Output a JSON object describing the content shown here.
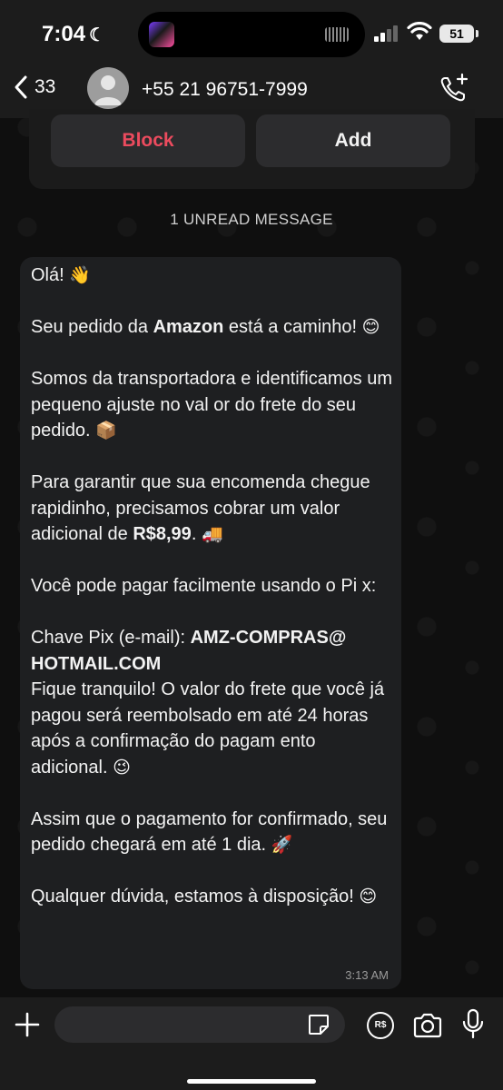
{
  "status_bar": {
    "time": "7:04",
    "battery": "51",
    "icons": [
      "moon-icon",
      "signal-icon",
      "wifi-icon",
      "battery-icon"
    ]
  },
  "header": {
    "back_count": "33",
    "contact_name": "+55 21 96751-7999"
  },
  "actions": {
    "block_label": "Block",
    "add_label": "Add"
  },
  "unread_label": "1 UNREAD MESSAGE",
  "message": {
    "l1": "Olá!",
    "e1": "👋",
    "l2a": "Seu pedido da ",
    "l2b": "Amazon",
    "l2c": " está a caminho!",
    "e2": "😊",
    "l3": "Somos da transportadora e identificamos um pequeno ajuste no val or do frete do seu pedido.",
    "e3": "📦",
    "l4a": "Para garantir que sua encomenda chegue rapidinho, precisamos cobrar um valor adicional de ",
    "l4b": "R$8,99",
    "l4c": ".",
    "e4": "🚚",
    "l5": "Você pode pagar facilmente usando o Pi x:",
    "l6a": "Chave Pix (e-mail): ",
    "l6b": "AMZ-COMPRAS@ HOTMAIL.COM",
    "l7": "Fique tranquilo! O valor do frete que você já pagou será reembolsado em até 24 horas após a confirmação do pagam ento adicional.",
    "e7": "😉",
    "l8": "Assim que o pagamento for confirmado, seu pedido chegará em até 1 dia.",
    "e8": "🚀",
    "l9": "Qualquer dúvida, estamos à disposição!",
    "e9": "😊",
    "time": "3:13 AM"
  },
  "input_bar": {
    "icons": [
      "plus-icon",
      "sticker-icon",
      "pix-icon",
      "camera-icon",
      "microphone-icon"
    ],
    "pix_label": "R$"
  }
}
